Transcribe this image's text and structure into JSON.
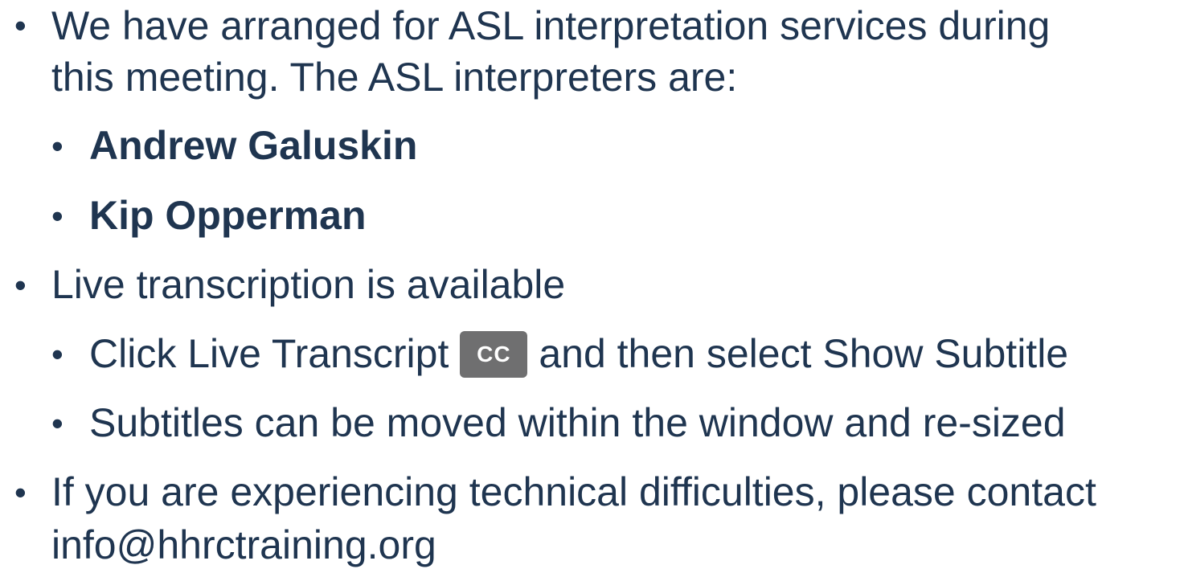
{
  "bullets": {
    "asl_line1": "We have arranged for ASL interpretation services during",
    "asl_line2": "this meeting. The ASL interpreters are:",
    "interpreter_1": "Andrew Galuskin",
    "interpreter_2": "Kip Opperman",
    "transcription": "Live transcription is available",
    "cc_before": "Click Live Transcript",
    "cc_badge": "CC",
    "cc_after": "and then select Show Subtitle",
    "subtitles": "Subtitles can be moved within the window and re-sized",
    "tech_line1": "If you are experiencing technical difficulties, please contact",
    "tech_line2": "info@hhrctraining.org"
  },
  "bullet_glyph": "•",
  "colors": {
    "text": "#1f3550",
    "cc_badge_bg": "#6f6f70"
  }
}
